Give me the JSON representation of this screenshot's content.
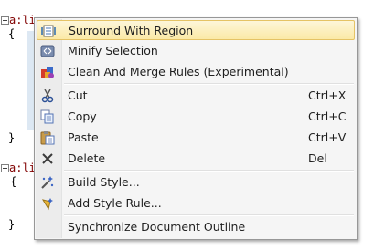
{
  "editor": {
    "line1_selector": "a:li",
    "line1_hidden_tail": "",
    "open_brace": "{",
    "close_brace": "}",
    "line2_selector": "a:li",
    "open_brace_2": "{",
    "close_brace_2": "}"
  },
  "menu": {
    "items": [
      {
        "label": "Surround With Region",
        "shortcut": "",
        "icon": "surround-region-icon"
      },
      {
        "label": "Minify Selection",
        "shortcut": "",
        "icon": "minify-icon"
      },
      {
        "label": "Clean And Merge Rules (Experimental)",
        "shortcut": "",
        "icon": "clean-merge-icon"
      },
      {
        "label": "Cut",
        "shortcut": "Ctrl+X",
        "icon": "scissors-icon"
      },
      {
        "label": "Copy",
        "shortcut": "Ctrl+C",
        "icon": "copy-icon"
      },
      {
        "label": "Paste",
        "shortcut": "Ctrl+V",
        "icon": "paste-icon"
      },
      {
        "label": "Delete",
        "shortcut": "Del",
        "icon": "delete-icon"
      },
      {
        "label": "Build Style...",
        "shortcut": "",
        "icon": "build-style-icon"
      },
      {
        "label": "Add Style Rule...",
        "shortcut": "",
        "icon": "add-style-rule-icon"
      },
      {
        "label": "Synchronize Document Outline",
        "shortcut": "",
        "icon": ""
      }
    ]
  },
  "colors": {
    "selector": "#800000",
    "highlight": "#fbe9a6",
    "menu_bg": "#f5f5f5"
  }
}
